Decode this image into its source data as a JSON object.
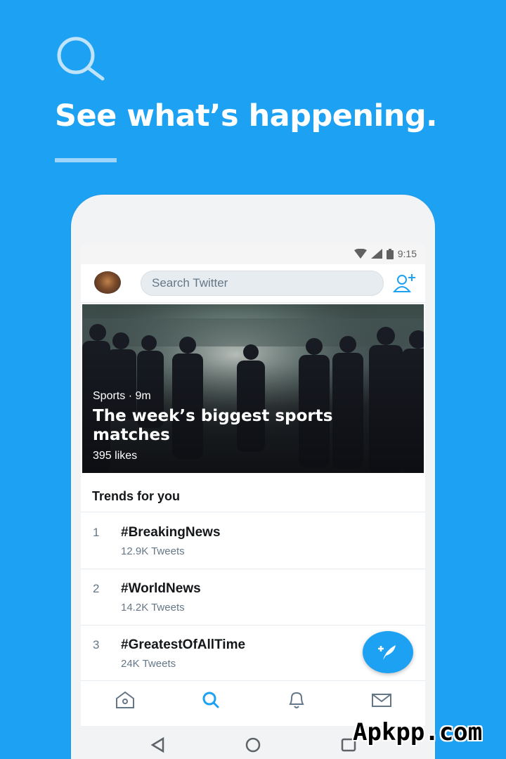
{
  "promo": {
    "icon": "search-icon",
    "headline": "See what’s happening."
  },
  "status_bar": {
    "time": "9:15",
    "icons": [
      "wifi-icon",
      "signal-icon",
      "battery-icon"
    ]
  },
  "header": {
    "avatar": "avatar",
    "search_placeholder": "Search Twitter",
    "add_user_icon": "add-user-icon"
  },
  "hero": {
    "meta": "Sports · 9m",
    "title": "The week’s biggest sports matches",
    "likes": "395 likes"
  },
  "trends": {
    "header": "Trends for you",
    "items": [
      {
        "rank": "1",
        "name": "#BreakingNews",
        "count": "12.9K Tweets"
      },
      {
        "rank": "2",
        "name": "#WorldNews",
        "count": "14.2K Tweets"
      },
      {
        "rank": "3",
        "name": "#GreatestOfAllTime",
        "count": "24K Tweets"
      }
    ]
  },
  "fab": {
    "icon": "compose-tweet-icon"
  },
  "bottom_nav": {
    "items": [
      "home-icon",
      "search-icon",
      "notifications-icon",
      "messages-icon"
    ],
    "active": "search-icon"
  },
  "system_nav": {
    "items": [
      "back-icon",
      "home-circle-icon",
      "recents-icon"
    ]
  },
  "colors": {
    "brand": "#1DA1F2",
    "text_primary": "#14171a",
    "text_secondary": "#657786"
  },
  "watermark": "Apkpp.com"
}
